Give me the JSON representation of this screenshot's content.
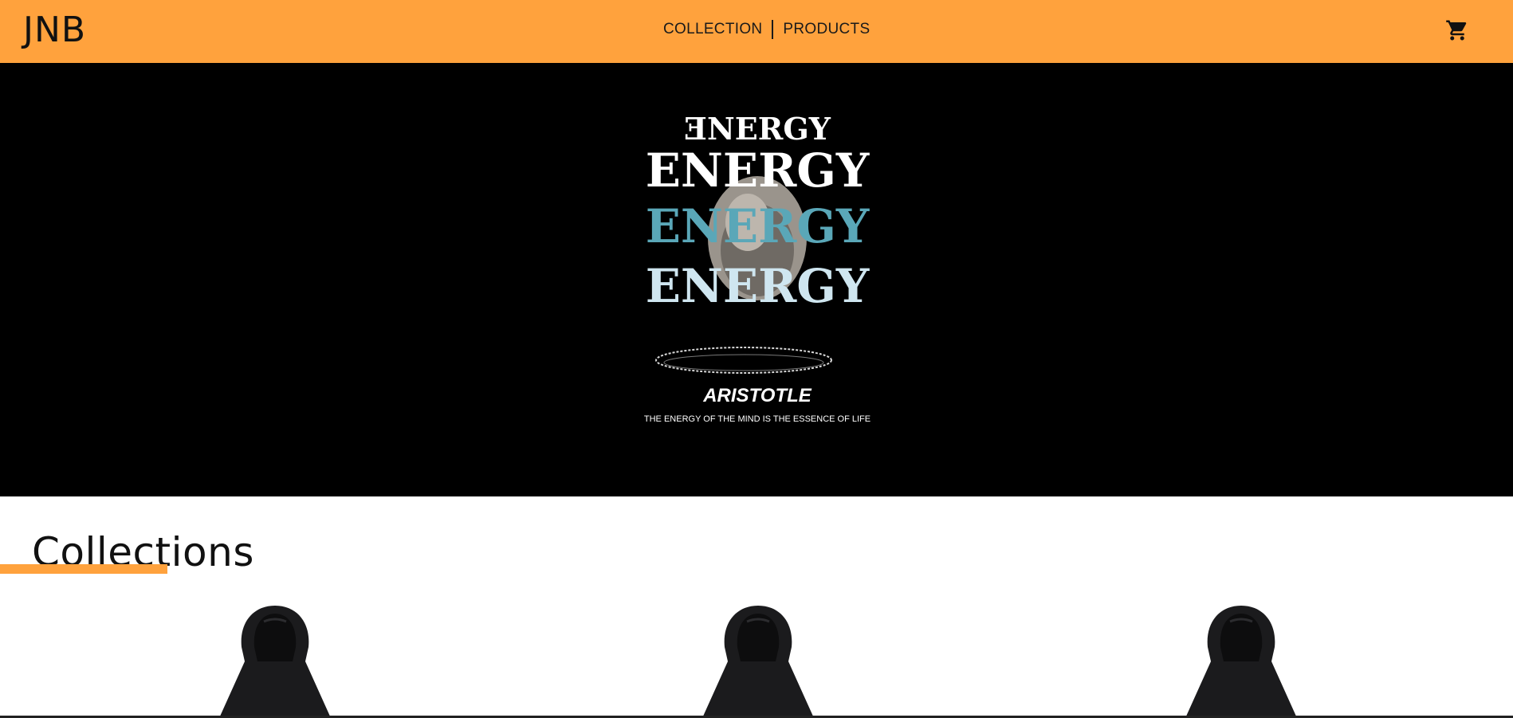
{
  "header": {
    "logo": "JNB",
    "nav": [
      {
        "label": "COLLECTION"
      },
      {
        "label": "PRODUCTS"
      }
    ],
    "cart_icon": "shopping-cart-icon"
  },
  "hero": {
    "art_words": [
      "ƎNERGY",
      "ENERGY",
      "ENERGY",
      "ENERGY"
    ],
    "art_title": "ARISTOTLE",
    "art_caption": "THE ENERGY OF THE MIND IS THE ESSENCE OF LIFE",
    "colors": {
      "background": "#000000",
      "white": "#ffffff",
      "teal": "#5aa7b8",
      "pale": "#cfe6f0"
    }
  },
  "collections": {
    "title": "Collections",
    "items": [
      {
        "image": "black-hoodie"
      },
      {
        "image": "black-hoodie"
      },
      {
        "image": "black-hoodie"
      }
    ]
  },
  "colors": {
    "accent": "#ffa23d",
    "text": "#111111"
  }
}
